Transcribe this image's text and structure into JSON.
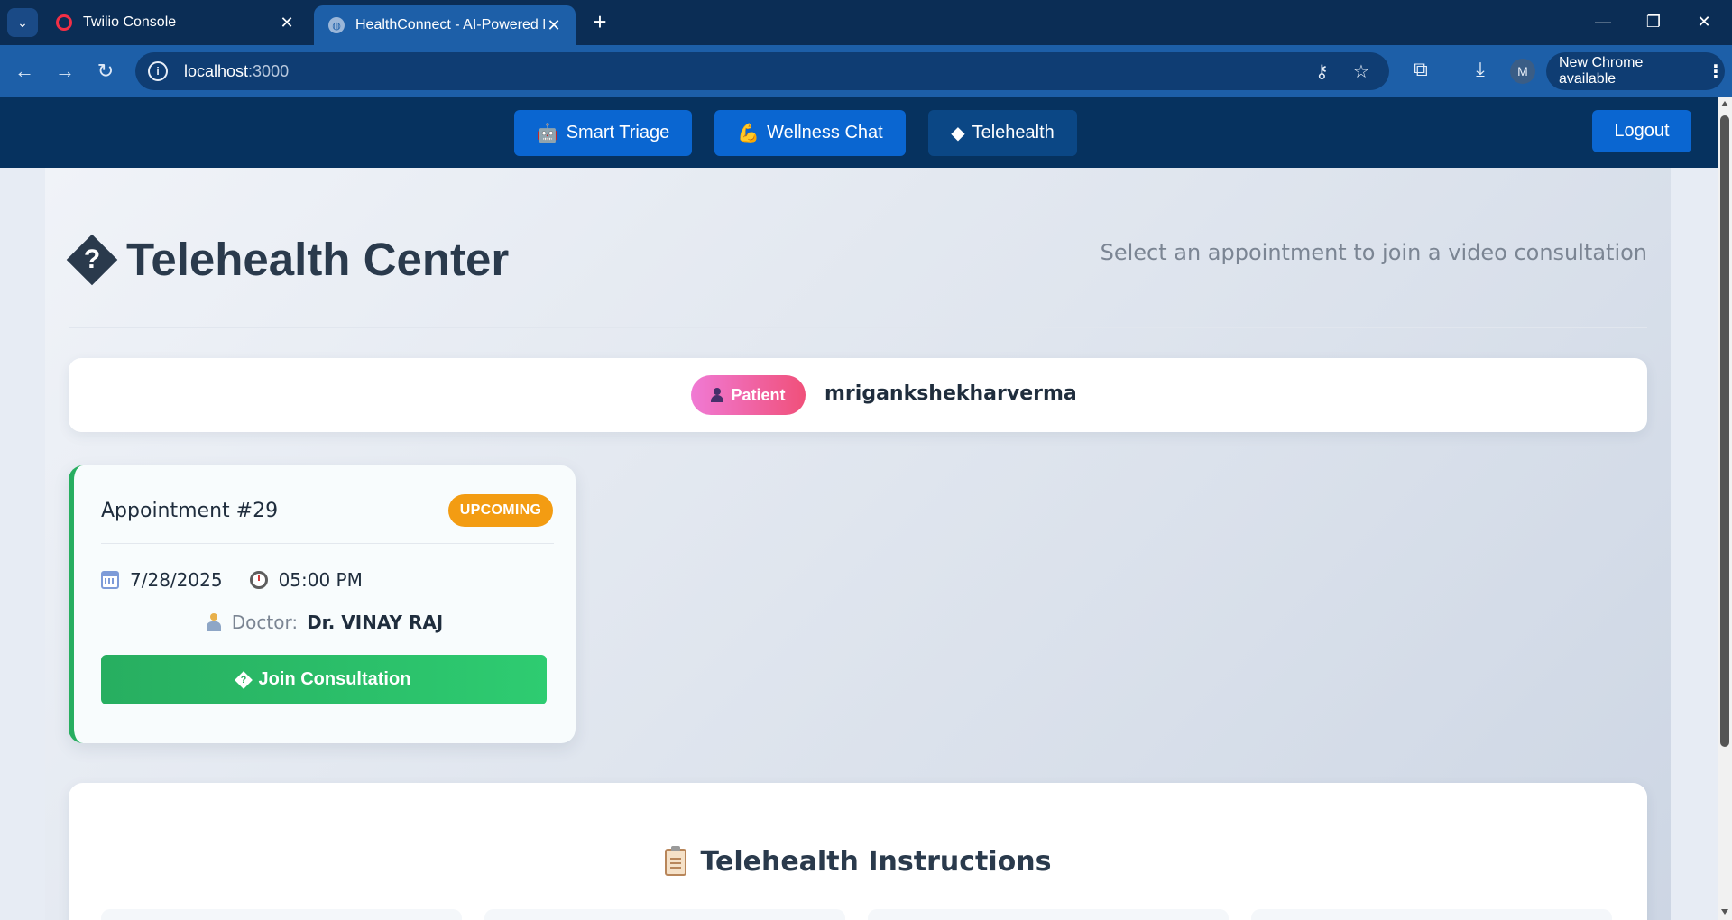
{
  "browser": {
    "tabs": [
      {
        "title": "Twilio Console",
        "active": false
      },
      {
        "title": "HealthConnect - AI-Powered Medical",
        "active": true
      }
    ],
    "url_host": "localhost",
    "url_port": ":3000",
    "profile_initial": "M",
    "update_label": "New Chrome available"
  },
  "nav": {
    "items": [
      {
        "label": "Smart Triage",
        "icon": "robot-icon"
      },
      {
        "label": "Wellness Chat",
        "icon": "flexed-biceps-icon"
      },
      {
        "label": "Telehealth",
        "icon": "unknown-glyph-icon"
      }
    ],
    "logout_label": "Logout"
  },
  "page": {
    "title": "Telehealth Center",
    "subtitle": "Select an appointment to join a video consultation"
  },
  "user": {
    "role": "Patient",
    "username": "mrigankshekharverma"
  },
  "appointment": {
    "title": "Appointment #29",
    "status": "UPCOMING",
    "date": "7/28/2025",
    "time": "05:00 PM",
    "doctor_label": "Doctor:",
    "doctor_name": "Dr. VINAY RAJ",
    "join_label": "Join Consultation"
  },
  "instructions": {
    "title": "Telehealth Instructions"
  },
  "colors": {
    "nav_bg": "#06325f",
    "nav_button": "#0a66d1",
    "status_upcoming": "#f39c12",
    "join_button": "#27ae60",
    "role_badge_start": "#f07ad4",
    "role_badge_end": "#f0507a"
  }
}
